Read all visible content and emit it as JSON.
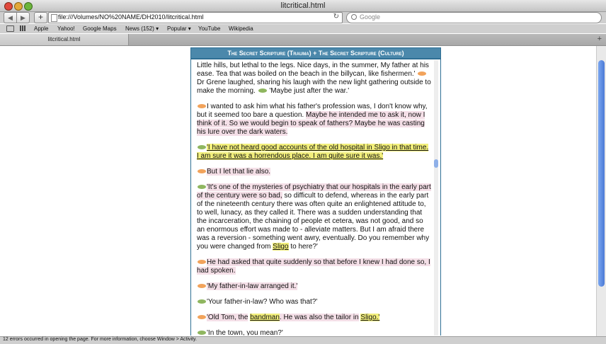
{
  "window": {
    "title": "litcritical.html"
  },
  "toolbar": {
    "back_label": "◀",
    "forward_label": "▶",
    "add_label": "+",
    "url": "file:///Volumes/NO%20NAME/DH2010/litcritical.html",
    "reload_label": "↻",
    "search_placeholder": "Google"
  },
  "bookmarks": [
    "Apple",
    "Yahoo!",
    "Google Maps",
    "News (152) ▾",
    "Popular ▾",
    "YouTube",
    "Wikipedia"
  ],
  "tabs": [
    {
      "label": "litcritical.html"
    }
  ],
  "new_tab_label": "+",
  "document": {
    "header": "The Secret Scripture (Trauma) + The Secret Scripture (Culture)",
    "p1_a": "Little hills, but lethal to the legs. Nice days, in the summer, My father at his ease. Tea that was boiled on the beach in the billycan, like fishermen.'",
    "p1_b": "Dr Grene laughed, sharing his laugh with the new light gathering outside to make the morning.",
    "p1_c": "'Maybe just after the war.'",
    "p2_a": "I wanted to ask him what his father's profession was, I don't know why, but it seemed too bare a question.",
    "p2_b": "Maybe he intended me to ask it, now I think of it. So we would begin to speak of fathers? Maybe he was casting his lure over the dark waters.",
    "p3": "'I have not heard good accounts of the old hospital in Sligo in that time. I am sure it was a horrendous place. I am quite sure it was.'",
    "p4": "But I let that lie also.",
    "p5_a": "'It's one of the mysteries of psychiatry that our hospitals in the early part of the century were so bad,",
    "p5_b": "so difficult to defend, whereas in the early part of the nineteenth century there was often quite an enlightened attitude to, to well, lunacy, as they called it. There was a sudden understanding that the incarceration, the chaining of people et cetera, was not good, and so an enormous effort was made to - alleviate matters. But I am afraid there was a reversion - something went awry, eventually. Do you remember why you were changed from",
    "p5_sligo": "Sligo",
    "p5_c": "to here?'",
    "p6": "He had asked that quite suddenly so that before I knew I had done so, I had spoken.",
    "p7": "'My father-in-law arranged it.'",
    "p8": "'Your father-in-law? Who was that?'",
    "p9_a": "'Old Tom, the",
    "p9_bandman": "bandman",
    "p9_b": ". He was also the tailor in",
    "p9_sligo": "Sligo.'",
    "p10": "'In the town, you mean?'"
  },
  "status": {
    "text": "12 errors occurred in opening the page. For more information, choose Window > Activity."
  },
  "colors": {
    "pink_highlight": "#f4dfe7",
    "yellow_highlight": "#f2ef7c",
    "header_blue": "#4b88ab",
    "orange_bubble": "#f2a35b",
    "green_bubble": "#8fb65f"
  }
}
